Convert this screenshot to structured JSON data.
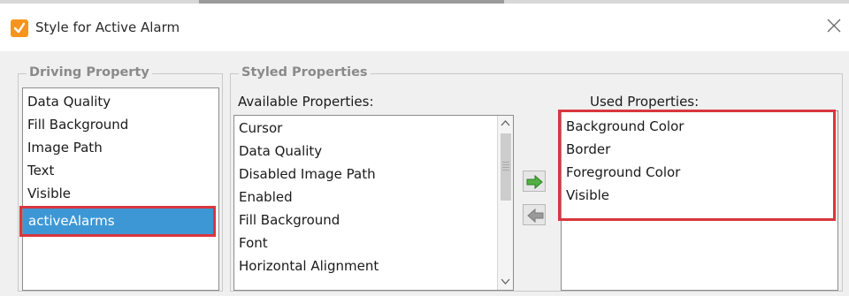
{
  "window": {
    "title": "Style for Active Alarm",
    "app_icon": "checkmark-app-icon",
    "close_icon": "close-icon"
  },
  "driving": {
    "legend": "Driving Property",
    "items": [
      "Data Quality",
      "Fill Background",
      "Image Path",
      "Text",
      "Visible",
      "activeAlarms"
    ],
    "selected": "activeAlarms"
  },
  "styled": {
    "legend": "Styled Properties",
    "available_label": "Available Properties:",
    "available": [
      "Cursor",
      "Data Quality",
      "Disabled Image Path",
      "Enabled",
      "Fill Background",
      "Font",
      "Horizontal Alignment"
    ],
    "used_label": "Used Properties:",
    "used": [
      "Background Color",
      "Border",
      "Foreground Color",
      "Visible"
    ]
  },
  "buttons": {
    "add_icon": "arrow-right-icon",
    "remove_icon": "arrow-left-icon"
  },
  "colors": {
    "selection": "#3e97d5",
    "highlight": "#d9363e",
    "add_arrow": "#52b043",
    "app_icon": "#f7941d"
  }
}
